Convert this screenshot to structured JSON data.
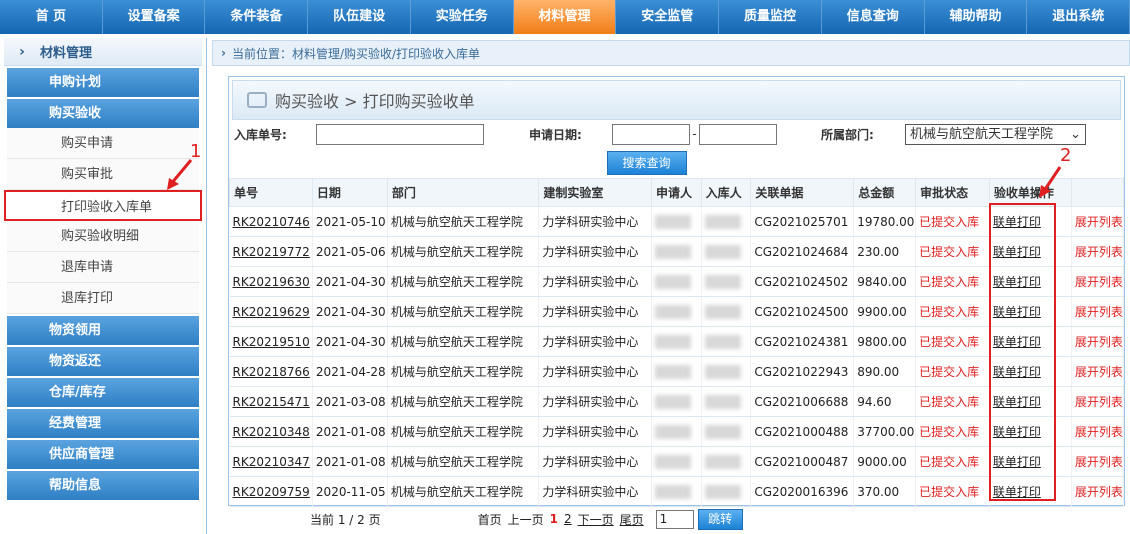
{
  "topnav": [
    "首 页",
    "设置备案",
    "条件装备",
    "队伍建设",
    "实验任务",
    "材料管理",
    "安全监管",
    "质量监控",
    "信息查询",
    "辅助帮助",
    "退出系统"
  ],
  "active_nav": "材料管理",
  "sidebar": {
    "title": "材料管理",
    "sections": [
      {
        "label": "申购计划",
        "items": []
      },
      {
        "label": "购买验收",
        "items": [
          "购买申请",
          "购买审批",
          "打印验收入库单",
          "购买验收明细",
          "退库申请",
          "退库打印"
        ]
      },
      {
        "label": "物资领用",
        "items": []
      },
      {
        "label": "物资返还",
        "items": []
      },
      {
        "label": "仓库/库存",
        "items": []
      },
      {
        "label": "经费管理",
        "items": []
      },
      {
        "label": "供应商管理",
        "items": []
      },
      {
        "label": "帮助信息",
        "items": []
      }
    ],
    "selected_item": "打印验收入库单"
  },
  "breadcrumb": "当前位置：材料管理/购买验收/打印验收入库单",
  "panel_title": "购买验收 > 打印购买验收单",
  "search": {
    "receipt_label": "入库单号:",
    "date_label": "申请日期:",
    "date_sep": "-",
    "dept_label": "所属部门:",
    "dept_value": "机械与航空航天工程学院",
    "search_button": "搜索查询"
  },
  "table": {
    "headers": [
      "单号",
      "日期",
      "部门",
      "建制实验室",
      "申请人",
      "入库人",
      "关联单据",
      "总金额",
      "审批状态",
      "验收单操作",
      ""
    ],
    "rows": [
      [
        "RK20210746",
        "2021-05-10",
        "机械与航空航天工程学院",
        "力学科研实验中心",
        "CG2021025701",
        "19780.00",
        "已提交入库",
        "联单打印",
        "展开列表"
      ],
      [
        "RK20219772",
        "2021-05-06",
        "机械与航空航天工程学院",
        "力学科研实验中心",
        "CG2021024684",
        "230.00",
        "已提交入库",
        "联单打印",
        "展开列表"
      ],
      [
        "RK20219630",
        "2021-04-30",
        "机械与航空航天工程学院",
        "力学科研实验中心",
        "CG2021024502",
        "9840.00",
        "已提交入库",
        "联单打印",
        "展开列表"
      ],
      [
        "RK20219629",
        "2021-04-30",
        "机械与航空航天工程学院",
        "力学科研实验中心",
        "CG2021024500",
        "9900.00",
        "已提交入库",
        "联单打印",
        "展开列表"
      ],
      [
        "RK20219510",
        "2021-04-30",
        "机械与航空航天工程学院",
        "力学科研实验中心",
        "CG2021024381",
        "9800.00",
        "已提交入库",
        "联单打印",
        "展开列表"
      ],
      [
        "RK20218766",
        "2021-04-28",
        "机械与航空航天工程学院",
        "力学科研实验中心",
        "CG2021022943",
        "890.00",
        "已提交入库",
        "联单打印",
        "展开列表"
      ],
      [
        "RK20215471",
        "2021-03-08",
        "机械与航空航天工程学院",
        "力学科研实验中心",
        "CG2021006688",
        "94.60",
        "已提交入库",
        "联单打印",
        "展开列表"
      ],
      [
        "RK20210348",
        "2021-01-08",
        "机械与航空航天工程学院",
        "力学科研实验中心",
        "CG2021000488",
        "37700.00",
        "已提交入库",
        "联单打印",
        "展开列表"
      ],
      [
        "RK20210347",
        "2021-01-08",
        "机械与航空航天工程学院",
        "力学科研实验中心",
        "CG2021000487",
        "9000.00",
        "已提交入库",
        "联单打印",
        "展开列表"
      ],
      [
        "RK20209759",
        "2020-11-05",
        "机械与航空航天工程学院",
        "力学科研实验中心",
        "CG2020016396",
        "370.00",
        "已提交入库",
        "联单打印",
        "展开列表"
      ]
    ]
  },
  "pager": {
    "page_info": "当前 1 / 2 页",
    "first": "首页",
    "prev": "上一页",
    "page1": "1",
    "page2": "2",
    "next": "下一页",
    "last": "尾页",
    "input_value": "1",
    "jump": "跳转"
  },
  "annotations": {
    "one": "1",
    "two": "2"
  }
}
